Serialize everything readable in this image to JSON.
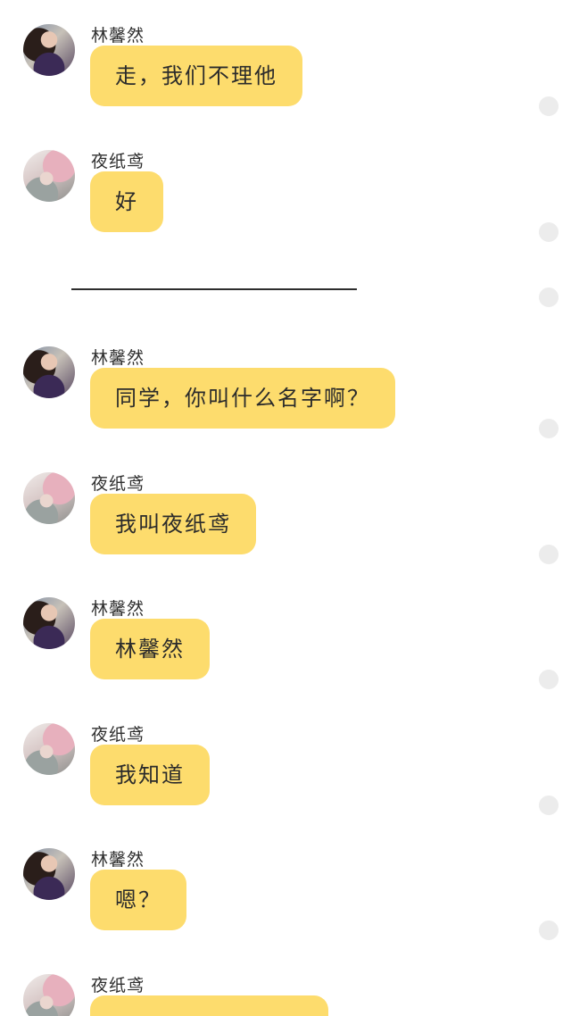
{
  "chat": {
    "messages": [
      {
        "sender": "林馨然",
        "text": "走，我们不理他"
      },
      {
        "sender": "夜纸鸢",
        "text": "好"
      },
      {
        "sender": "林馨然",
        "text": "同学，你叫什么名字啊？"
      },
      {
        "sender": "夜纸鸢",
        "text": "我叫夜纸鸢"
      },
      {
        "sender": "林馨然",
        "text": "林馨然"
      },
      {
        "sender": "夜纸鸢",
        "text": "我知道"
      },
      {
        "sender": "林馨然",
        "text": "嗯？"
      },
      {
        "sender": "夜纸鸢",
        "text": ""
      }
    ]
  },
  "colors": {
    "bubble": "#fddc6d",
    "background": "#ffffff",
    "side_dot": "#ececec"
  },
  "icons": {
    "avatar_lin": "avatar-林馨然",
    "avatar_ye": "avatar-夜纸鸢",
    "side_dot": "circle-dot-icon"
  }
}
